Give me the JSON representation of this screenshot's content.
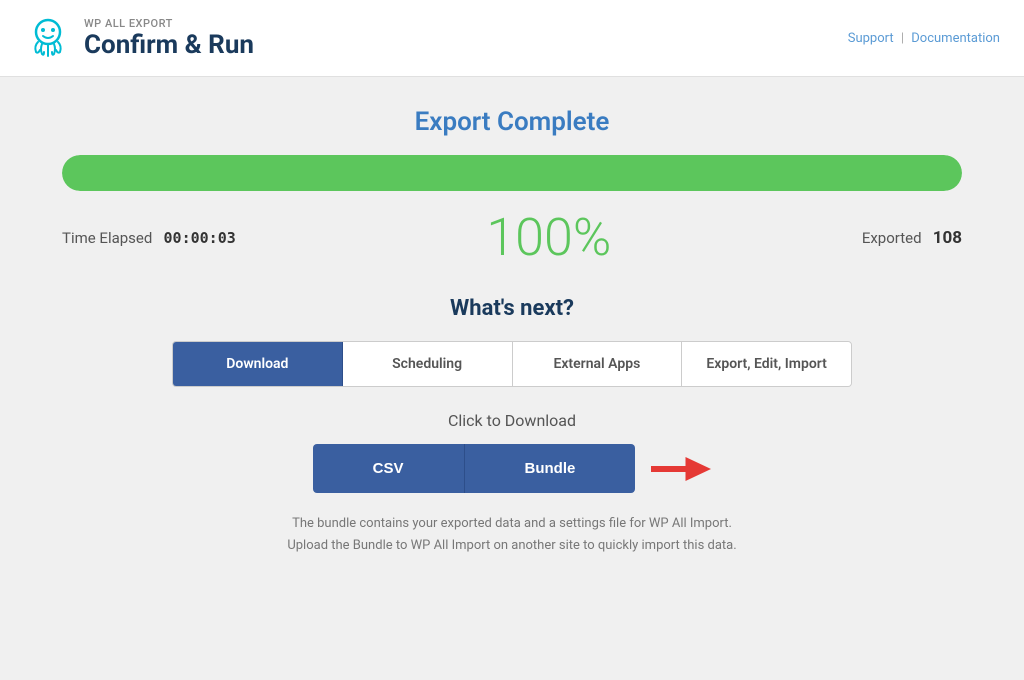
{
  "header": {
    "subtitle": "WP ALL EXPORT",
    "title": "Confirm & Run",
    "links": {
      "support": "Support",
      "separator": "|",
      "documentation": "Documentation"
    }
  },
  "main": {
    "export_complete_label": "Export Complete",
    "progress": {
      "percent": 100,
      "display_percent": "100%"
    },
    "time_elapsed_label": "Time Elapsed",
    "time_elapsed_value": "00:00:03",
    "exported_label": "Exported",
    "exported_count": "108",
    "whats_next_label": "What's next?",
    "tabs": [
      {
        "id": "download",
        "label": "Download",
        "active": true
      },
      {
        "id": "scheduling",
        "label": "Scheduling",
        "active": false
      },
      {
        "id": "external-apps",
        "label": "External Apps",
        "active": false
      },
      {
        "id": "export-edit-import",
        "label": "Export, Edit, Import",
        "active": false
      }
    ],
    "click_to_download_label": "Click to Download",
    "buttons": {
      "csv_label": "CSV",
      "bundle_label": "Bundle"
    },
    "info_text_line1": "The bundle contains your exported data and a settings file for WP All Import.",
    "info_text_line2": "Upload the Bundle to WP All Import on another site to quickly import this data."
  }
}
